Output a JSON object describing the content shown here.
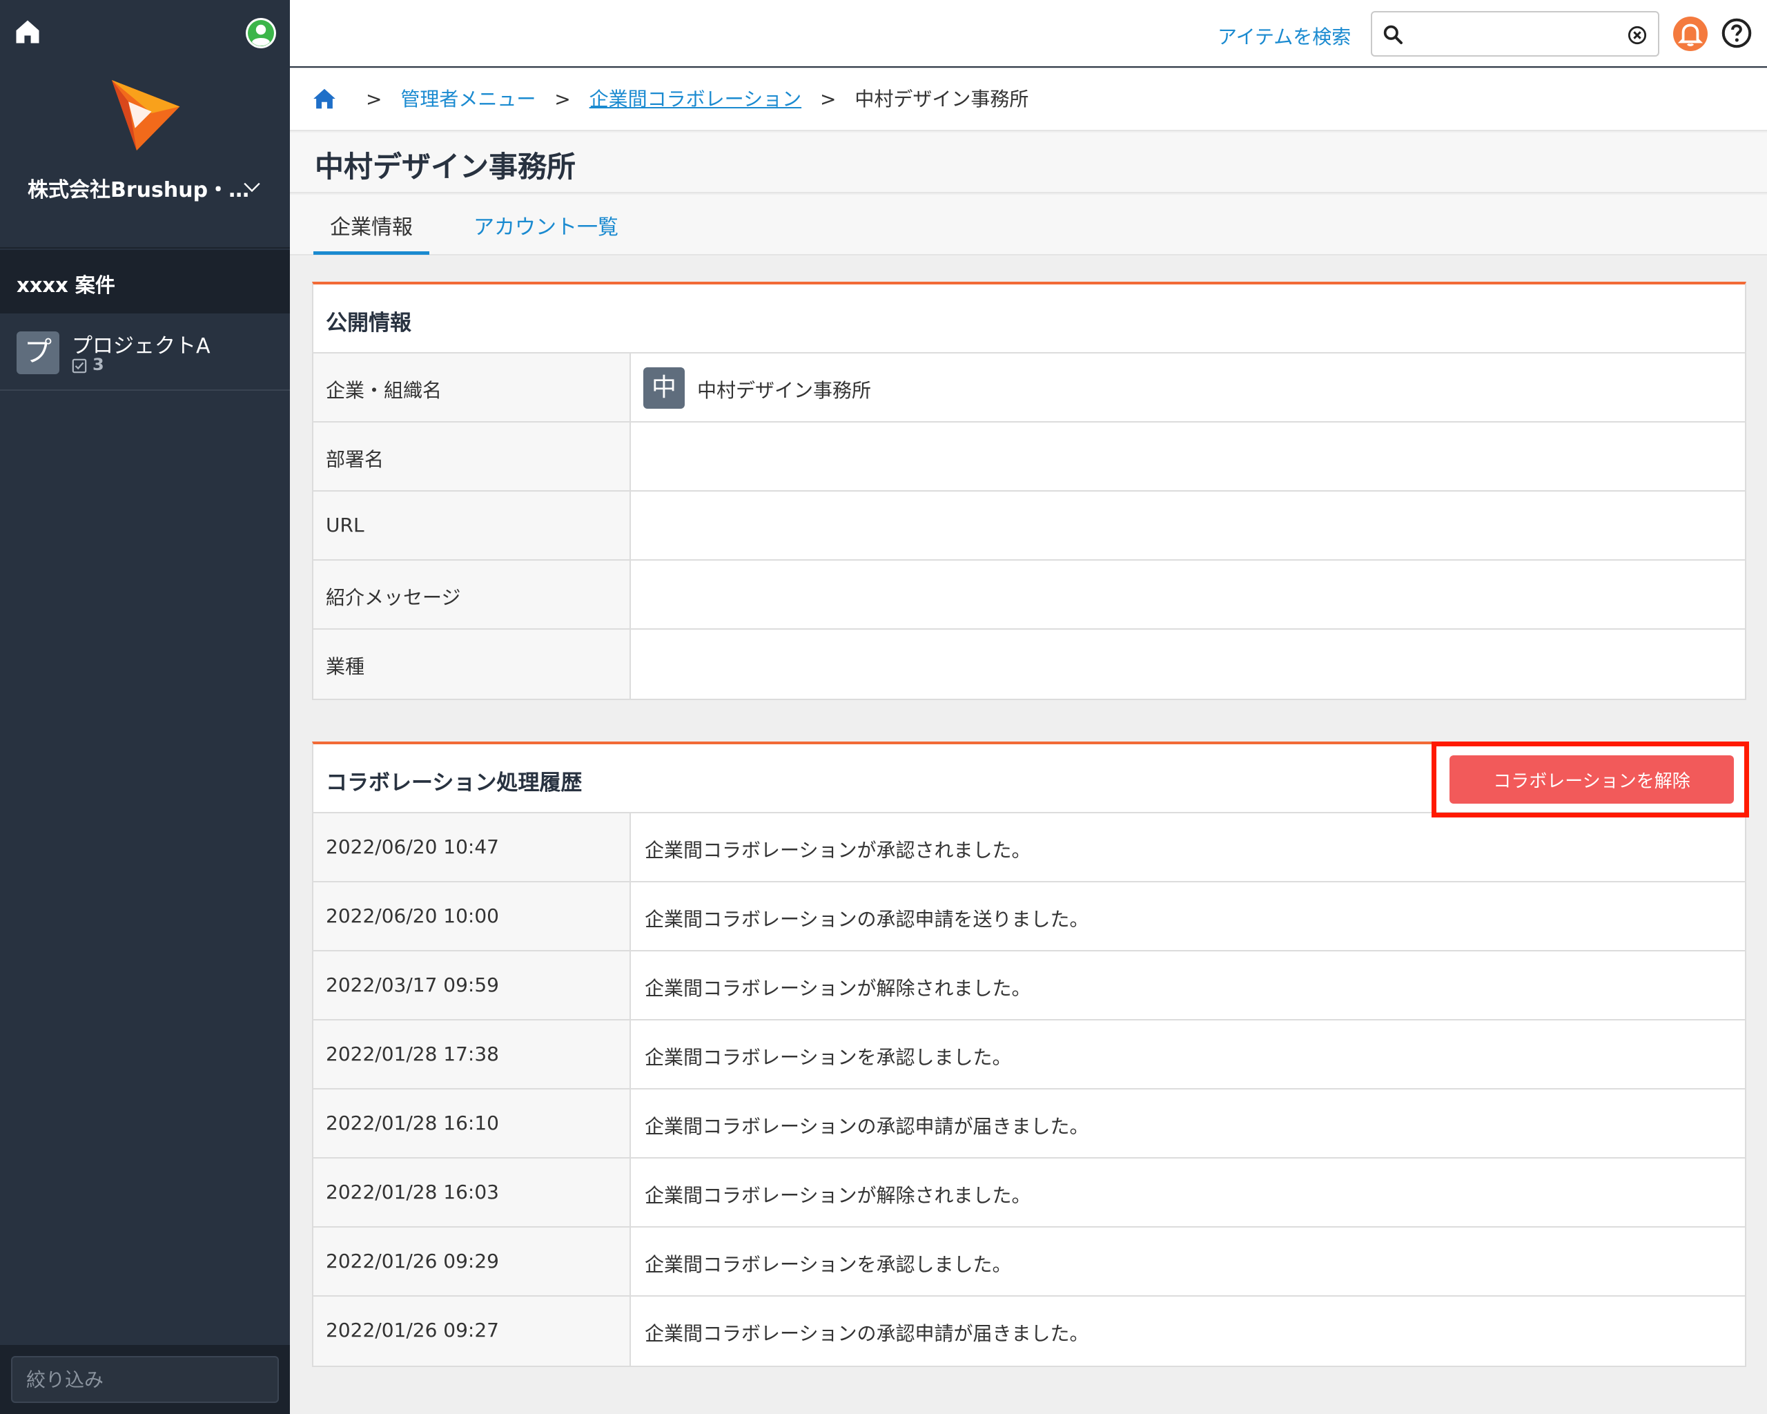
{
  "sidebar": {
    "org_name": "株式会社Brushup・…",
    "section_title": "xxxx 案件",
    "project": {
      "avatar": "プ",
      "name": "プロジェクトA",
      "count": "3"
    },
    "filter_placeholder": "絞り込み"
  },
  "header": {
    "search_label": "アイテムを検索",
    "search_value": ""
  },
  "breadcrumb": {
    "sep": ">",
    "admin_menu": "管理者メニュー",
    "collab": "企業間コラボレーション",
    "current": "中村デザイン事務所"
  },
  "page_title": "中村デザイン事務所",
  "tabs": {
    "company_info": "企業情報",
    "account_list": "アカウント一覧"
  },
  "public_info": {
    "title": "公開情報",
    "rows": [
      {
        "label": "企業・組織名",
        "value": "中村デザイン事務所",
        "avatar": "中"
      },
      {
        "label": "部署名",
        "value": ""
      },
      {
        "label": "URL",
        "value": ""
      },
      {
        "label": "紹介メッセージ",
        "value": ""
      },
      {
        "label": "業種",
        "value": ""
      }
    ]
  },
  "history": {
    "title": "コラボレーション処理履歴",
    "release_button": "コラボレーションを解除",
    "rows": [
      {
        "time": "2022/06/20 10:47",
        "message": "企業間コラボレーションが承認されました。"
      },
      {
        "time": "2022/06/20 10:00",
        "message": "企業間コラボレーションの承認申請を送りました。"
      },
      {
        "time": "2022/03/17 09:59",
        "message": "企業間コラボレーションが解除されました。"
      },
      {
        "time": "2022/01/28 17:38",
        "message": "企業間コラボレーションを承認しました。"
      },
      {
        "time": "2022/01/28 16:10",
        "message": "企業間コラボレーションの承認申請が届きました。"
      },
      {
        "time": "2022/01/28 16:03",
        "message": "企業間コラボレーションが解除されました。"
      },
      {
        "time": "2022/01/26 09:29",
        "message": "企業間コラボレーションを承認しました。"
      },
      {
        "time": "2022/01/26 09:27",
        "message": "企業間コラボレーションの承認申請が届きました。"
      }
    ]
  },
  "colors": {
    "sidebar_bg": "#283240",
    "accent_blue": "#1a8ad0",
    "accent_orange": "#f26a36",
    "danger": "#f25a5a",
    "highlight": "#ff1a00"
  },
  "icons": [
    "home-icon",
    "user-icon",
    "brand-logo",
    "chevron-down-icon",
    "task-check-icon",
    "search-icon",
    "clear-icon",
    "bell-icon",
    "help-icon"
  ]
}
